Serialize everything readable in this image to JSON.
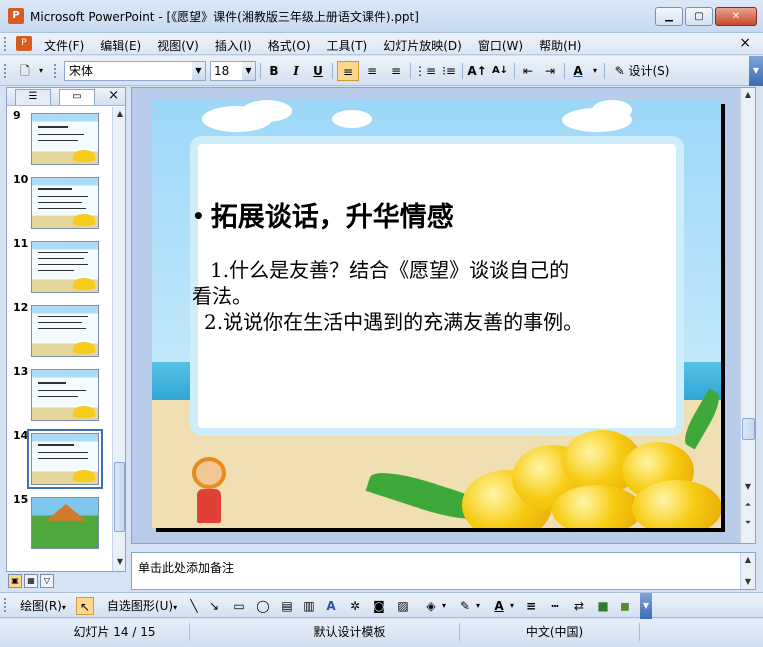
{
  "window": {
    "title": "Microsoft PowerPoint - [《愿望》课件(湘教版三年级上册语文课件).ppt]"
  },
  "menu": {
    "items": [
      "文件(F)",
      "编辑(E)",
      "视图(V)",
      "插入(I)",
      "格式(O)",
      "工具(T)",
      "幻灯片放映(D)",
      "窗口(W)",
      "帮助(H)"
    ],
    "close": "×"
  },
  "toolbar": {
    "font_name": "宋体",
    "font_size": "18",
    "bold": "B",
    "italic": "I",
    "underline": "U",
    "design_label": "设计(S)"
  },
  "left_pane": {
    "close": "×",
    "slides": [
      {
        "number": "9"
      },
      {
        "number": "10"
      },
      {
        "number": "11"
      },
      {
        "number": "12"
      },
      {
        "number": "13"
      },
      {
        "number": "14"
      },
      {
        "number": "15"
      }
    ],
    "selected_slide": "14"
  },
  "slide": {
    "title": "拓展谈话，升华情感",
    "lines": [
      "1.什么是友善？结合《愿望》谈谈自己的",
      "看法。",
      "2.说说你在生活中遇到的充满友善的事例。"
    ]
  },
  "notes": {
    "placeholder": "单击此处添加备注"
  },
  "draw_toolbar": {
    "draw_label": "绘图(R)",
    "autoshapes_label": "自选图形(U)"
  },
  "status": {
    "slide_info": "幻灯片 14 / 15",
    "template": "默认设计模板",
    "language": "中文(中国)"
  },
  "colors": {
    "accent": "#3f6fb7",
    "pressed": "#fbd88b"
  }
}
